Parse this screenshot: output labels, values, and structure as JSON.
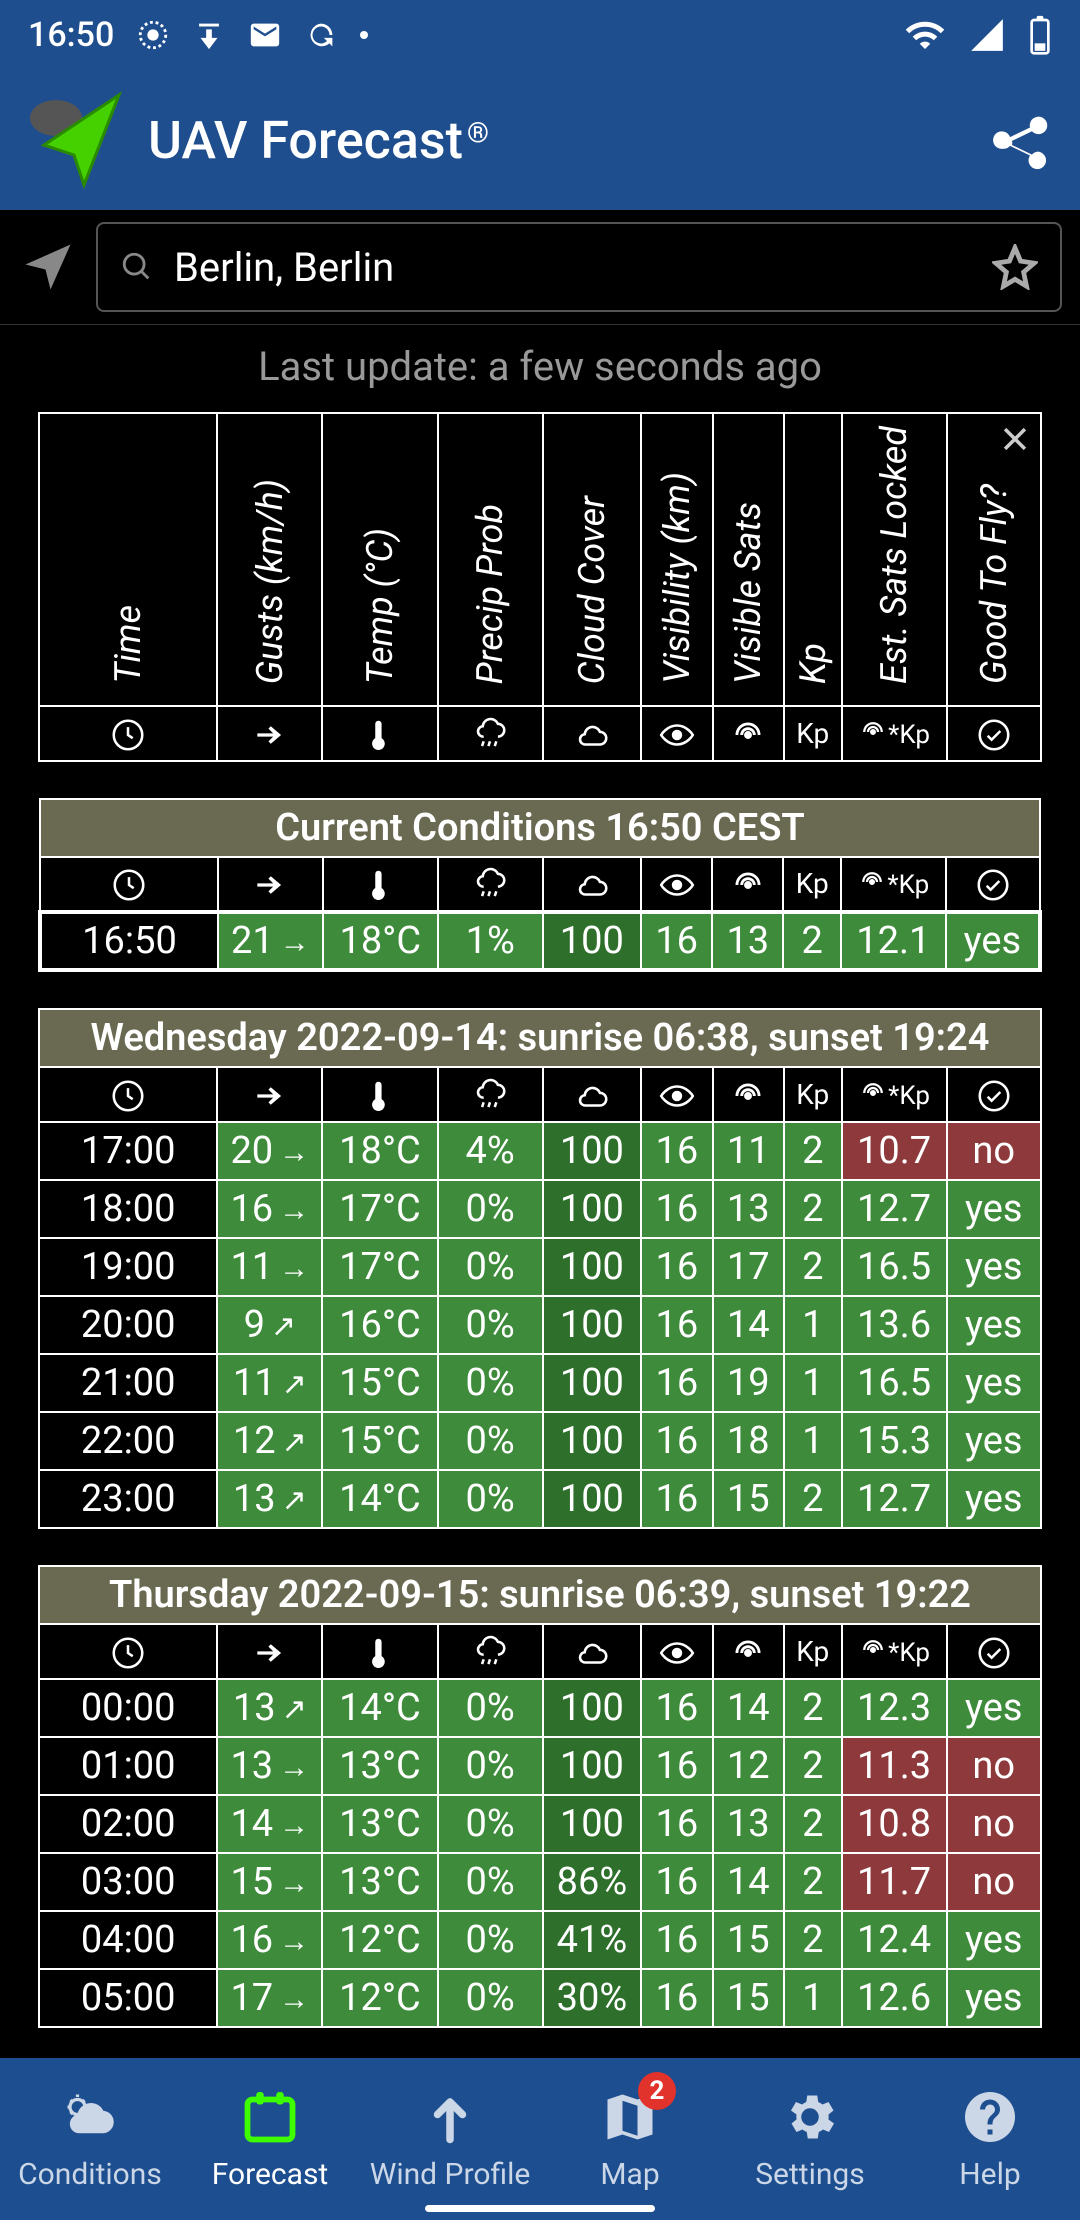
{
  "status": {
    "time": "16:50"
  },
  "topbar": {
    "title": "UAV Forecast",
    "trademark": "®"
  },
  "search": {
    "location": "Berlin, Berlin"
  },
  "last_update": "Last update: a few seconds ago",
  "headers": {
    "time": "Time",
    "gusts": "Gusts (km/h)",
    "temp": "Temp (°C)",
    "precip": "Precip Prob",
    "cloud": "Cloud Cover",
    "vis": "Visibility (km)",
    "vsats": "Visible Sats",
    "kp": "Kp",
    "skp": "Est. Sats Locked",
    "fly": "Good To Fly?"
  },
  "icon_row_labels": {
    "kp": "Kp",
    "skp": "*Kp"
  },
  "current": {
    "title": "Current Conditions 16:50 CEST",
    "row": {
      "time": "16:50",
      "gust": "21",
      "gust_dir": "→",
      "temp": "18°C",
      "precip": "1%",
      "cloud": "100",
      "vis": "16",
      "vsats": "13",
      "kp": "2",
      "skp": "12.1",
      "fly": "yes",
      "cl": [
        "green",
        "green",
        "green",
        "green2",
        "green",
        "green",
        "green",
        "green",
        "green"
      ]
    }
  },
  "days": [
    {
      "header": "Wednesday 2022-09-14: sunrise 06:38, sunset 19:24",
      "rows": [
        {
          "time": "17:00",
          "gust": "20",
          "gust_dir": "→",
          "temp": "18°C",
          "precip": "4%",
          "cloud": "100",
          "vis": "16",
          "vsats": "11",
          "kp": "2",
          "skp": "10.7",
          "fly": "no",
          "cl": [
            "green",
            "green",
            "green",
            "green2",
            "green",
            "green",
            "green",
            "red",
            "red"
          ]
        },
        {
          "time": "18:00",
          "gust": "16",
          "gust_dir": "→",
          "temp": "17°C",
          "precip": "0%",
          "cloud": "100",
          "vis": "16",
          "vsats": "13",
          "kp": "2",
          "skp": "12.7",
          "fly": "yes",
          "cl": [
            "green",
            "green",
            "green",
            "green2",
            "green",
            "green",
            "green",
            "green",
            "green"
          ]
        },
        {
          "time": "19:00",
          "gust": "11",
          "gust_dir": "→",
          "temp": "17°C",
          "precip": "0%",
          "cloud": "100",
          "vis": "16",
          "vsats": "17",
          "kp": "2",
          "skp": "16.5",
          "fly": "yes",
          "cl": [
            "green",
            "green",
            "green",
            "green2",
            "green",
            "green",
            "green",
            "green",
            "green"
          ]
        },
        {
          "time": "20:00",
          "gust": "9",
          "gust_dir": "↗",
          "temp": "16°C",
          "precip": "0%",
          "cloud": "100",
          "vis": "16",
          "vsats": "14",
          "kp": "1",
          "skp": "13.6",
          "fly": "yes",
          "cl": [
            "green",
            "green",
            "green",
            "green2",
            "green",
            "green",
            "green",
            "green",
            "green"
          ]
        },
        {
          "time": "21:00",
          "gust": "11",
          "gust_dir": "↗",
          "temp": "15°C",
          "precip": "0%",
          "cloud": "100",
          "vis": "16",
          "vsats": "19",
          "kp": "1",
          "skp": "16.5",
          "fly": "yes",
          "cl": [
            "green",
            "green",
            "green",
            "green2",
            "green",
            "green",
            "green",
            "green",
            "green"
          ]
        },
        {
          "time": "22:00",
          "gust": "12",
          "gust_dir": "↗",
          "temp": "15°C",
          "precip": "0%",
          "cloud": "100",
          "vis": "16",
          "vsats": "18",
          "kp": "1",
          "skp": "15.3",
          "fly": "yes",
          "cl": [
            "green",
            "green",
            "green",
            "green2",
            "green",
            "green",
            "green",
            "green",
            "green"
          ]
        },
        {
          "time": "23:00",
          "gust": "13",
          "gust_dir": "↗",
          "temp": "14°C",
          "precip": "0%",
          "cloud": "100",
          "vis": "16",
          "vsats": "15",
          "kp": "2",
          "skp": "12.7",
          "fly": "yes",
          "cl": [
            "green",
            "green",
            "green",
            "green2",
            "green",
            "green",
            "green",
            "green",
            "green"
          ]
        }
      ]
    },
    {
      "header": "Thursday 2022-09-15: sunrise 06:39, sunset 19:22",
      "rows": [
        {
          "time": "00:00",
          "gust": "13",
          "gust_dir": "↗",
          "temp": "14°C",
          "precip": "0%",
          "cloud": "100",
          "vis": "16",
          "vsats": "14",
          "kp": "2",
          "skp": "12.3",
          "fly": "yes",
          "cl": [
            "green",
            "green",
            "green",
            "green2",
            "green",
            "green",
            "green",
            "green",
            "green"
          ]
        },
        {
          "time": "01:00",
          "gust": "13",
          "gust_dir": "→",
          "temp": "13°C",
          "precip": "0%",
          "cloud": "100",
          "vis": "16",
          "vsats": "12",
          "kp": "2",
          "skp": "11.3",
          "fly": "no",
          "cl": [
            "green",
            "green",
            "green",
            "green2",
            "green",
            "green",
            "green",
            "red",
            "red"
          ]
        },
        {
          "time": "02:00",
          "gust": "14",
          "gust_dir": "→",
          "temp": "13°C",
          "precip": "0%",
          "cloud": "100",
          "vis": "16",
          "vsats": "13",
          "kp": "2",
          "skp": "10.8",
          "fly": "no",
          "cl": [
            "green",
            "green",
            "green",
            "green2",
            "green",
            "green",
            "green",
            "red",
            "red"
          ]
        },
        {
          "time": "03:00",
          "gust": "15",
          "gust_dir": "→",
          "temp": "13°C",
          "precip": "0%",
          "cloud": "86%",
          "vis": "16",
          "vsats": "14",
          "kp": "2",
          "skp": "11.7",
          "fly": "no",
          "cl": [
            "green",
            "green",
            "green",
            "green2",
            "green",
            "green",
            "green",
            "red",
            "red"
          ]
        },
        {
          "time": "04:00",
          "gust": "16",
          "gust_dir": "→",
          "temp": "12°C",
          "precip": "0%",
          "cloud": "41%",
          "vis": "16",
          "vsats": "15",
          "kp": "2",
          "skp": "12.4",
          "fly": "yes",
          "cl": [
            "green",
            "green",
            "green",
            "green2",
            "green",
            "green",
            "green",
            "green",
            "green"
          ]
        },
        {
          "time": "05:00",
          "gust": "17",
          "gust_dir": "→",
          "temp": "12°C",
          "precip": "0%",
          "cloud": "30%",
          "vis": "16",
          "vsats": "15",
          "kp": "1",
          "skp": "12.6",
          "fly": "yes",
          "cl": [
            "green",
            "green",
            "green",
            "green2",
            "green",
            "green",
            "green",
            "green",
            "green"
          ]
        }
      ]
    }
  ],
  "nav": {
    "conditions": "Conditions",
    "forecast": "Forecast",
    "wind": "Wind Profile",
    "map": "Map",
    "map_badge": "2",
    "settings": "Settings",
    "help": "Help"
  }
}
